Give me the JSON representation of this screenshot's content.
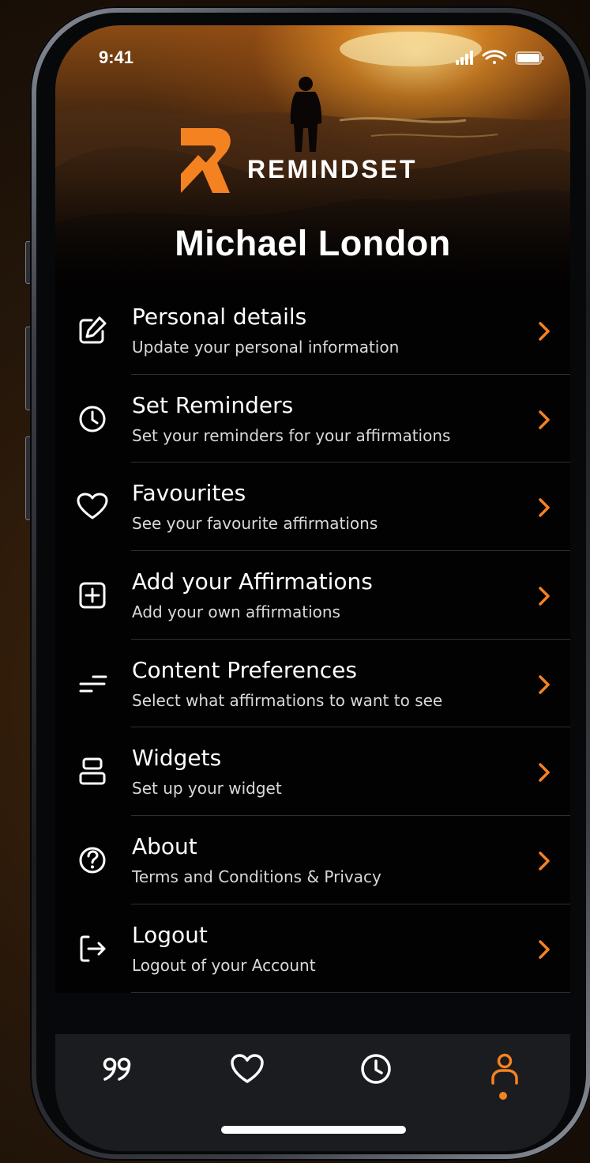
{
  "status_bar": {
    "time": "9:41",
    "icons": [
      "signal-icon",
      "wifi-icon",
      "battery-icon"
    ]
  },
  "brand": {
    "name": "REMINDSET",
    "accent_color": "#f58220"
  },
  "profile": {
    "user_name": "Michael London"
  },
  "menu": {
    "items": [
      {
        "title": "Personal details",
        "subtitle": "Update your personal information",
        "icon": "edit-icon"
      },
      {
        "title": "Set Reminders",
        "subtitle": "Set your reminders for your affirmations",
        "icon": "clock-icon"
      },
      {
        "title": "Favourites",
        "subtitle": "See your favourite affirmations",
        "icon": "heart-icon"
      },
      {
        "title": "Add your Affirmations",
        "subtitle": "Add your own affirmations",
        "icon": "plus-square-icon"
      },
      {
        "title": "Content Preferences",
        "subtitle": "Select what affirmations to want to see",
        "icon": "filter-icon"
      },
      {
        "title": "Widgets",
        "subtitle": "Set up your widget",
        "icon": "widgets-icon"
      },
      {
        "title": "About",
        "subtitle": "Terms and Conditions & Privacy",
        "icon": "help-circle-icon"
      },
      {
        "title": "Logout",
        "subtitle": "Logout of your Account",
        "icon": "logout-icon"
      }
    ]
  },
  "tab_bar": {
    "tabs": [
      {
        "icon": "quote-icon",
        "active": false
      },
      {
        "icon": "heart-icon",
        "active": false
      },
      {
        "icon": "clock-icon",
        "active": false
      },
      {
        "icon": "profile-icon",
        "active": true
      }
    ]
  }
}
